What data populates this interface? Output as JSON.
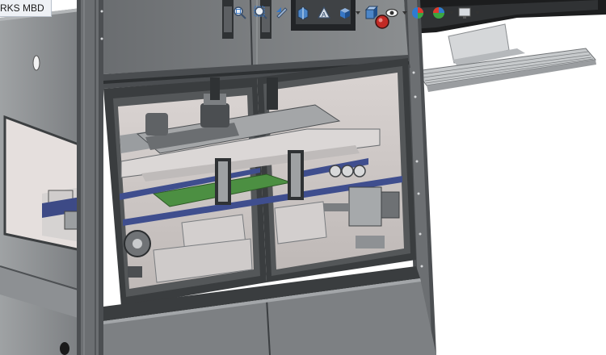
{
  "document_tab": {
    "label": "RKS MBD"
  },
  "heads_up_toolbar": {
    "tools": [
      {
        "name": "zoom-to-fit-icon"
      },
      {
        "name": "zoom-to-area-icon"
      },
      {
        "name": "previous-view-icon"
      },
      {
        "name": "section-view-icon"
      },
      {
        "name": "dynamic-annotation-icon"
      },
      {
        "name": "view-orientation-icon"
      },
      {
        "name": "display-style-icon"
      },
      {
        "name": "hide-show-items-icon"
      },
      {
        "name": "edit-appearance-icon"
      },
      {
        "name": "apply-scene-icon"
      },
      {
        "name": "view-settings-icon"
      }
    ]
  },
  "colors": {
    "frame": "#5b5e61",
    "frame_dark": "#3e4143",
    "panel": "#818486",
    "window_bg": "#cfc9c6",
    "rail_blue": "#3f4e8e",
    "pcb_green": "#4c8f42",
    "background": "#ffffff"
  }
}
